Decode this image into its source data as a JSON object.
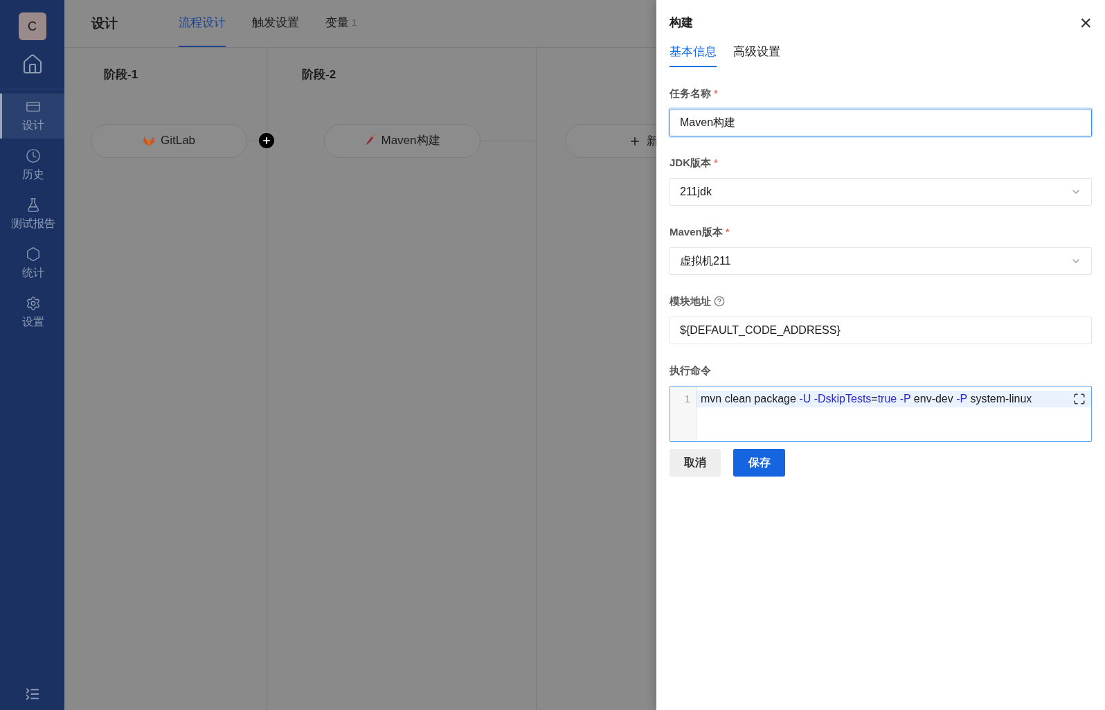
{
  "sidebar": {
    "avatar": "C",
    "items": [
      {
        "label": "设计",
        "selected": true
      },
      {
        "label": "历史",
        "selected": false
      },
      {
        "label": "测试报告",
        "selected": false
      },
      {
        "label": "统计",
        "selected": false
      },
      {
        "label": "设置",
        "selected": false
      }
    ]
  },
  "header": {
    "title": "设计",
    "tabs": [
      {
        "label": "流程设计",
        "selected": true
      },
      {
        "label": "触发设置",
        "selected": false
      },
      {
        "label": "变量",
        "badge": "1",
        "selected": false
      }
    ]
  },
  "stages": [
    {
      "title": "阶段-1",
      "node": {
        "kind": "gitlab",
        "label": "GitLab"
      }
    },
    {
      "title": "阶段-2",
      "node": {
        "kind": "maven",
        "label": "Maven构建"
      }
    },
    {
      "node": {
        "kind": "add",
        "label": "新"
      }
    }
  ],
  "drawer": {
    "title": "构建",
    "close": "×",
    "tabs": [
      {
        "label": "基本信息",
        "selected": true
      },
      {
        "label": "高级设置",
        "selected": false
      }
    ],
    "fields": [
      {
        "kind": "text",
        "label": "任务名称",
        "required_mark": "*",
        "value": "Maven构建",
        "focused": true
      },
      {
        "kind": "select",
        "label": "JDK版本",
        "required_mark": "*",
        "value": "211jdk"
      },
      {
        "kind": "select",
        "label": "Maven版本",
        "required_mark": "*",
        "value": "虚拟机211"
      },
      {
        "kind": "text",
        "label": "模块地址",
        "help": true,
        "value": "${DEFAULT_CODE_ADDRESS}",
        "focused": false
      },
      {
        "kind": "code",
        "label": "执行命令",
        "line_number": "1",
        "tokens": [
          {
            "text": "mvn clean package ",
            "kind": "plain"
          },
          {
            "text": "-U ",
            "kind": "keyword"
          },
          {
            "text": "-DskipTests",
            "kind": "keyword"
          },
          {
            "text": "=",
            "kind": "plain"
          },
          {
            "text": "true ",
            "kind": "keyword"
          },
          {
            "text": "-P ",
            "kind": "keyword"
          },
          {
            "text": "env-dev ",
            "kind": "plain"
          },
          {
            "text": "-P ",
            "kind": "keyword"
          },
          {
            "text": "system-linux",
            "kind": "plain"
          }
        ]
      }
    ],
    "buttons": [
      {
        "label": "取消",
        "kind": "secondary"
      },
      {
        "label": "保存",
        "kind": "primary"
      }
    ]
  }
}
